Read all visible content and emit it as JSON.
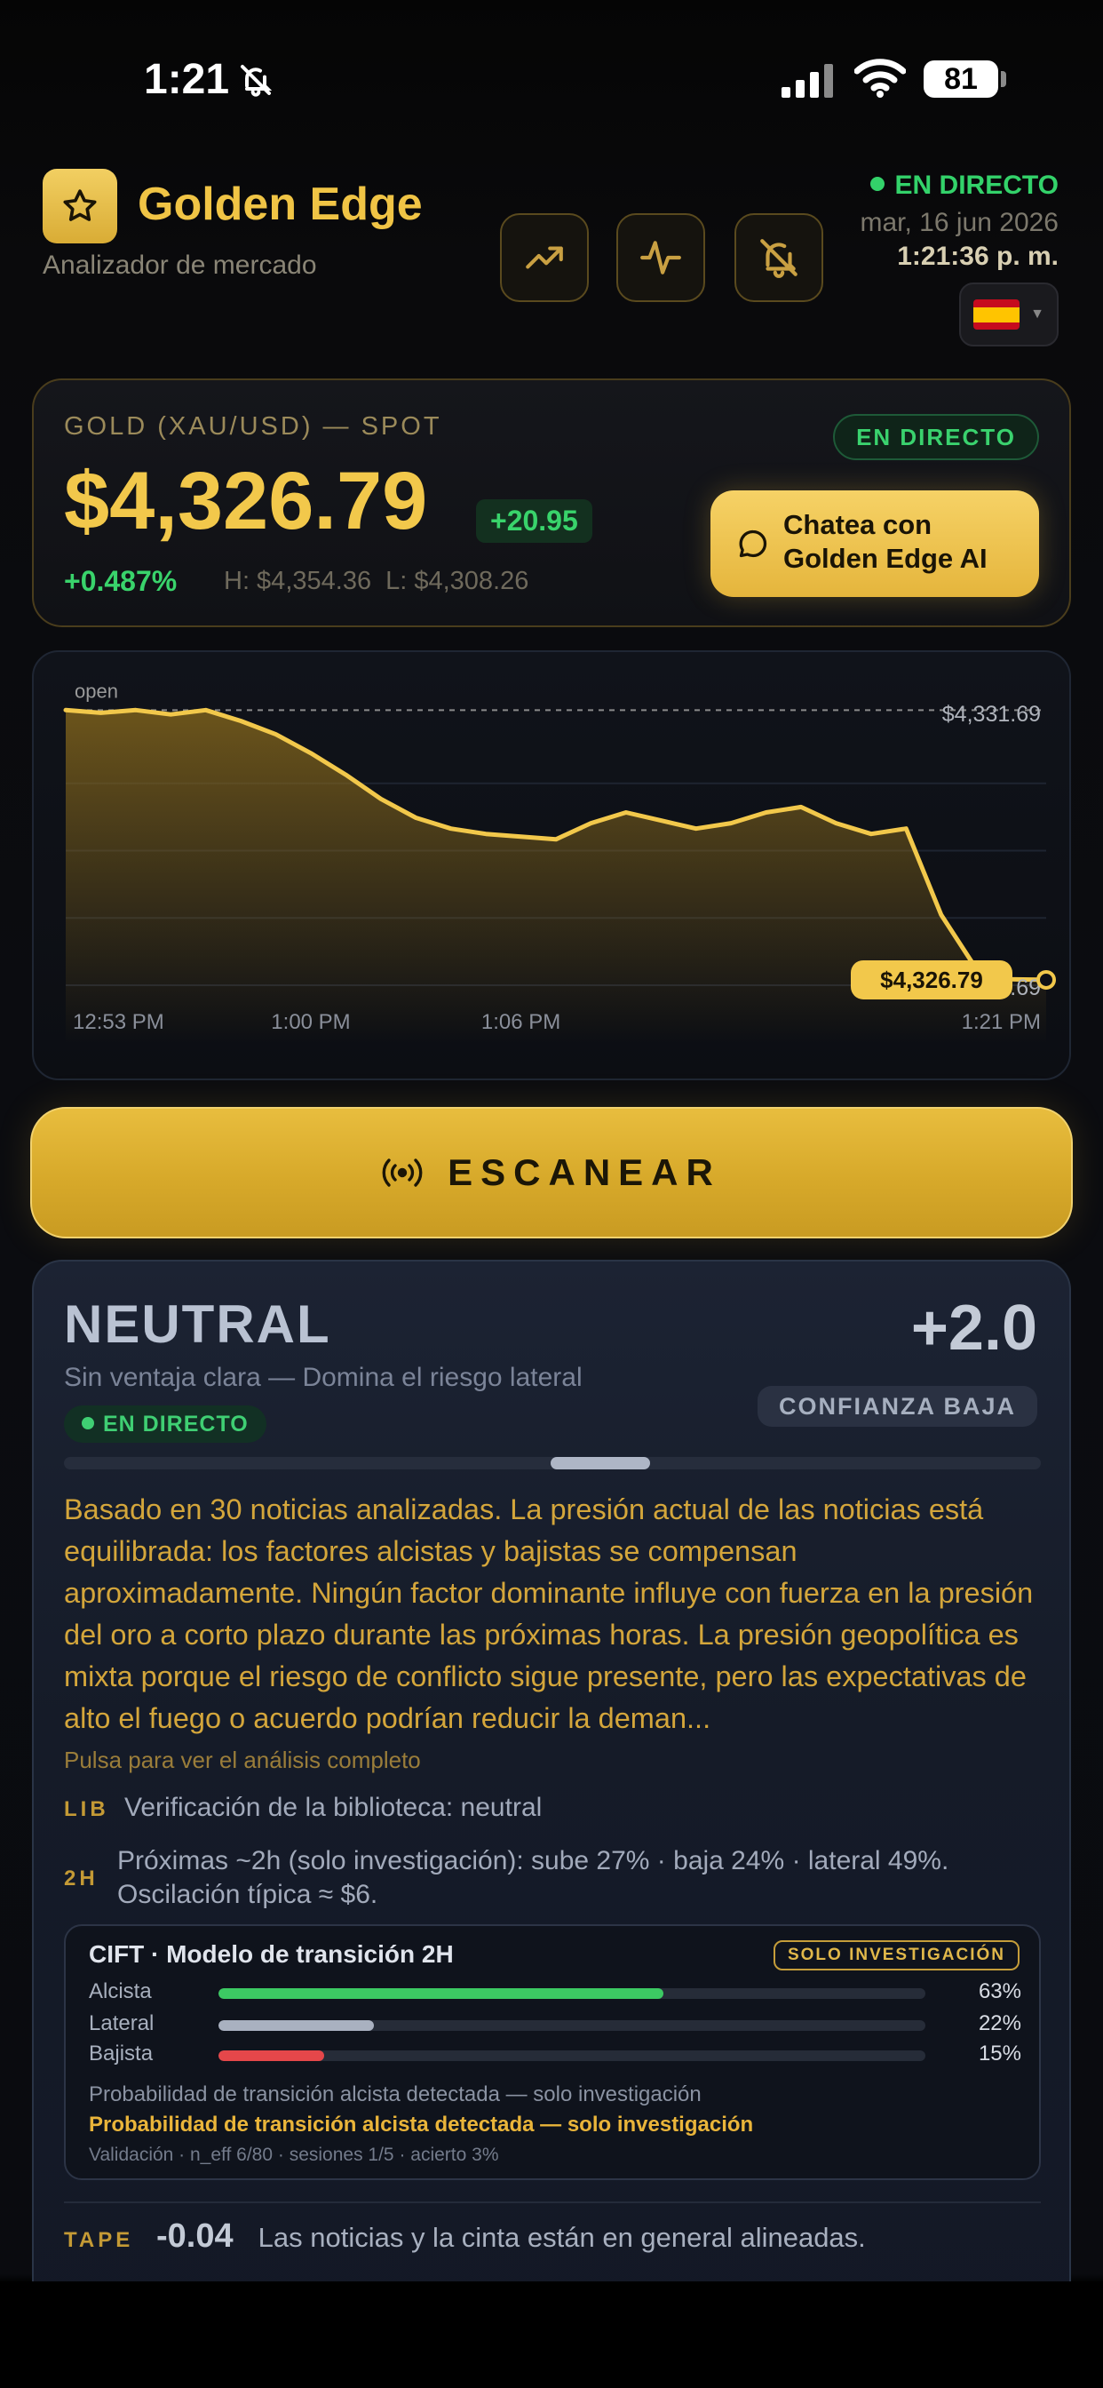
{
  "status_bar": {
    "time": "1:21",
    "battery": "81"
  },
  "header": {
    "title": "Golden Edge",
    "subtitle": "Analizador de mercado",
    "live": "EN DIRECTO",
    "date": "mar, 16 jun 2026",
    "clock": "1:21:36 p. m.",
    "language_flag": "spain-flag-icon"
  },
  "price_card": {
    "label": "GOLD (XAU/USD) — SPOT",
    "price": "$4,326.79",
    "change": "+20.95",
    "change_pct": "+0.487%",
    "high": "H: $4,354.36",
    "low": "L: $4,308.26",
    "live_badge": "EN DIRECTO",
    "chat_line1": "Chatea con",
    "chat_line2": "Golden Edge AI"
  },
  "chart": {
    "open_label": "open",
    "high_label": "$4,331.69",
    "low_label": "$4,326.69",
    "current_label": "$4,326.79",
    "x_ticks": [
      "12:53 PM",
      "1:00 PM",
      "1:06 PM",
      "1:21 PM"
    ]
  },
  "chart_data": {
    "type": "area",
    "x": [
      "12:53",
      "12:54",
      "12:55",
      "12:56",
      "12:57",
      "12:58",
      "12:59",
      "1:00",
      "1:01",
      "1:02",
      "1:03",
      "1:04",
      "1:05",
      "1:06",
      "1:07",
      "1:08",
      "1:09",
      "1:10",
      "1:11",
      "1:12",
      "1:13",
      "1:14",
      "1:15",
      "1:16",
      "1:17",
      "1:18",
      "1:19",
      "1:20",
      "1:21"
    ],
    "values": [
      4331.8,
      4331.75,
      4331.8,
      4331.72,
      4331.8,
      4331.6,
      4331.35,
      4331.0,
      4330.6,
      4330.15,
      4329.8,
      4329.6,
      4329.5,
      4329.45,
      4329.4,
      4329.7,
      4329.9,
      4329.75,
      4329.6,
      4329.7,
      4329.9,
      4330.0,
      4329.7,
      4329.5,
      4329.6,
      4328.0,
      4327.0,
      4326.8,
      4326.79
    ],
    "open": 4331.8,
    "ylim": [
      4326.69,
      4331.69
    ],
    "x_ticks": [
      "12:53 PM",
      "1:00 PM",
      "1:06 PM",
      "1:21 PM"
    ],
    "colors": {
      "line": "#f2c84b",
      "fill": "#8a6a1c"
    }
  },
  "scan_button": {
    "label": "ESCANEAR"
  },
  "analysis": {
    "title": "NEUTRAL",
    "score": "+2.0",
    "subtitle": "Sin ventaja clara — Domina el riesgo lateral",
    "confidence": "CONFIANZA BAJA",
    "live": "EN DIRECTO",
    "text": "Basado en 30 noticias analizadas. La presión actual de las noticias está equilibrada: los factores alcistas y bajistas se compensan aproximadamente. Ningún factor dominante influye con fuerza en la presión del oro a corto plazo durante las próximas horas. La presión geopolítica es mixta porque el riesgo de conflicto sigue presente, pero las expectativas de alto el fuego o acuerdo podrían reducir la deman...",
    "hint": "Pulsa para ver el análisis completo",
    "lib_tag": "LIB",
    "lib_text": "Verificación de la biblioteca: neutral",
    "h2_tag": "2H",
    "h2_line1": "Próximas ~2h (solo investigación): sube 27% · baja 24% · lateral 49%.",
    "h2_line2": "Oscilación típica ≈ $6.",
    "cift": {
      "title": "CIFT · Modelo de transición 2H",
      "badge": "SOLO INVESTIGACIÓN",
      "rows": [
        {
          "name": "Alcista",
          "pct": "63%",
          "value": 0.63,
          "color": "#3cc963"
        },
        {
          "name": "Lateral",
          "pct": "22%",
          "value": 0.22,
          "color": "#a9b1c0"
        },
        {
          "name": "Bajista",
          "pct": "15%",
          "value": 0.15,
          "color": "#e5474a"
        }
      ],
      "note1": "Probabilidad de transición alcista detectada — solo investigación",
      "note2": "Probabilidad de transición alcista detectada — solo investigación",
      "validation": "Validación · n_eff 6/80 · sesiones 1/5 · acierto 3%"
    },
    "tape_tag": "TAPE",
    "tape_value": "-0.04",
    "tape_text": "Las noticias y la cinta están en general alineadas."
  }
}
